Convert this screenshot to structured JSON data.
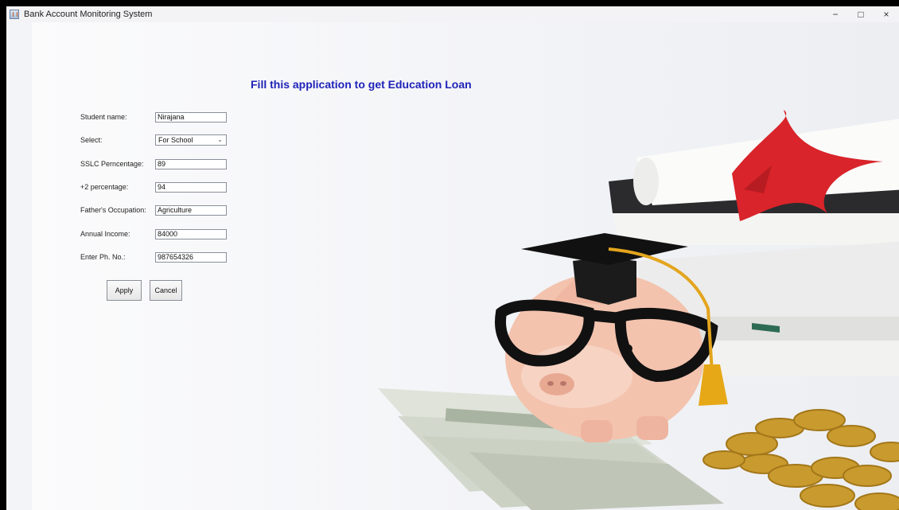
{
  "window": {
    "title": "Bank Account Monitoring System"
  },
  "controls": {
    "minimize": "−",
    "maximize": "□",
    "close": "×"
  },
  "heading": "Fill this application to get Education Loan",
  "form": {
    "student_name": {
      "label": "Student name:",
      "value": "Nirajana"
    },
    "select": {
      "label": "Select:",
      "value": "For School"
    },
    "sslc": {
      "label": "SSLC Perncentage:",
      "value": "89"
    },
    "plus_two": {
      "label": "+2 percentage:",
      "value": "94"
    },
    "father_occupation": {
      "label": "Father's Occupation:",
      "value": "Agriculture"
    },
    "annual_income": {
      "label": "Annual Income:",
      "value": "84000"
    },
    "phone": {
      "label": "Enter Ph. No.:",
      "value": "987654326"
    }
  },
  "buttons": {
    "apply": "Apply",
    "cancel": "Cancel"
  },
  "colors": {
    "heading": "#1f23b8",
    "ribbon": "#d8242a",
    "coin": "#c99a2e"
  }
}
